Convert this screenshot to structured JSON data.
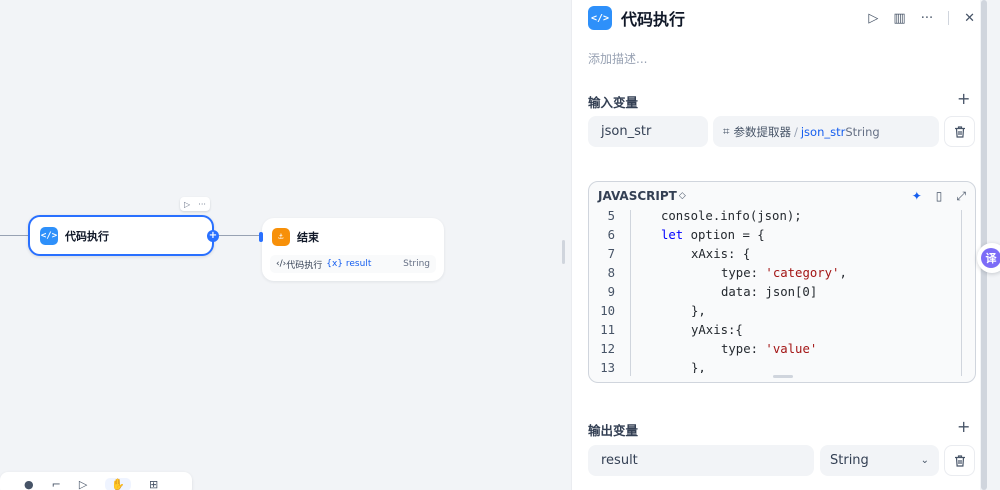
{
  "canvas": {
    "code_node": {
      "icon": "code-icon",
      "title": "代码执行"
    },
    "end_node": {
      "icon": "flag-icon",
      "title": "结束",
      "row": {
        "source": "代码执行",
        "variable": "{x} result",
        "type": "String"
      }
    }
  },
  "panel": {
    "title": "代码执行",
    "description_placeholder": "添加描述...",
    "input_section": {
      "title": "输入变量",
      "rows": [
        {
          "name": "json_str",
          "ref_node": "参数提取器",
          "ref_sep": "/",
          "ref_var": "json_str",
          "ref_type": "String"
        }
      ]
    },
    "editor": {
      "language": "JAVASCRIPT",
      "lines": [
        {
          "num": "5",
          "indent": 1,
          "text": "console.info(json);"
        },
        {
          "num": "6",
          "indent": 1,
          "text": "let option = {"
        },
        {
          "num": "7",
          "indent": 2,
          "text": "xAxis: {"
        },
        {
          "num": "8",
          "indent": 3,
          "text": "type: 'category',"
        },
        {
          "num": "9",
          "indent": 3,
          "text": "data: json[0]"
        },
        {
          "num": "10",
          "indent": 2,
          "text": "},"
        },
        {
          "num": "11",
          "indent": 2,
          "text": "yAxis:{"
        },
        {
          "num": "12",
          "indent": 3,
          "text": "type: 'value'"
        },
        {
          "num": "13",
          "indent": 2,
          "text": "},"
        }
      ]
    },
    "output_section": {
      "title": "输出变量",
      "rows": [
        {
          "name": "result",
          "type": "String"
        }
      ]
    }
  },
  "translate_button": "译"
}
